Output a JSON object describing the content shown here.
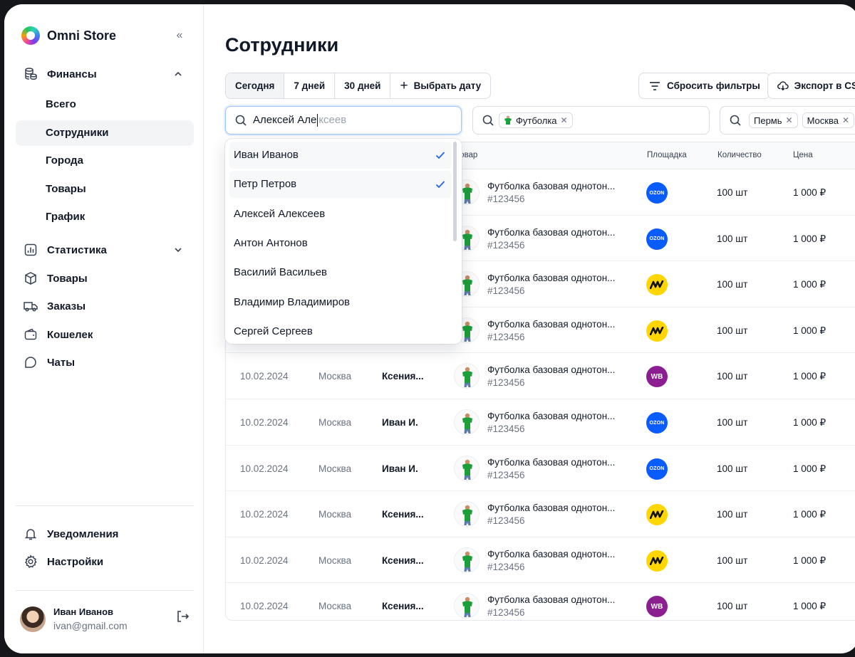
{
  "brand": {
    "name": "Omni Store"
  },
  "sidebar": {
    "finance": {
      "label": "Финансы",
      "icon": "coins-icon"
    },
    "finance_sub": [
      {
        "label": "Всего"
      },
      {
        "label": "Сотрудники"
      },
      {
        "label": "Города"
      },
      {
        "label": "Товары"
      },
      {
        "label": "График"
      }
    ],
    "items": [
      {
        "label": "Статистика",
        "icon": "chart-icon"
      },
      {
        "label": "Товары",
        "icon": "box-icon"
      },
      {
        "label": "Заказы",
        "icon": "truck-icon"
      },
      {
        "label": "Кошелек",
        "icon": "wallet-icon"
      },
      {
        "label": "Чаты",
        "icon": "chat-icon"
      }
    ],
    "bottom": [
      {
        "label": "Уведомления",
        "icon": "bell-icon"
      },
      {
        "label": "Настройки",
        "icon": "gear-icon"
      }
    ],
    "user": {
      "name": "Иван Иванов",
      "email": "ivan@gmail.com"
    }
  },
  "main": {
    "title": "Сотрудники",
    "periods": [
      "Сегодня",
      "7 дней",
      "30 дней",
      "Выбрать дату"
    ],
    "reset_label": "Сбросить фильтры",
    "export_label": "Экспорт в CSV",
    "employee_search": {
      "typed": "Алексей Але",
      "suggestion": "ксеев"
    },
    "product_filter": {
      "chip": "Футболка"
    },
    "city_filter": {
      "chips": [
        "Пермь",
        "Москва"
      ]
    },
    "columns": {
      "product": "Товар",
      "marketplace": "Площадка",
      "quantity": "Количество",
      "price": "Цена"
    },
    "rows": [
      {
        "date": "",
        "city": "",
        "employee": "",
        "product": "Футболка базовая однотон...",
        "sku": "#123456",
        "marketplace": "ozon",
        "qty": "100 шт",
        "price": "1 000 ₽"
      },
      {
        "date": "",
        "city": "",
        "employee": "",
        "product": "Футболка базовая однотон...",
        "sku": "#123456",
        "marketplace": "ozon",
        "qty": "100 шт",
        "price": "1 000 ₽"
      },
      {
        "date": "",
        "city": "",
        "employee": "",
        "product": "Футболка базовая однотон...",
        "sku": "#123456",
        "marketplace": "yandex-market",
        "qty": "100 шт",
        "price": "1 000 ₽"
      },
      {
        "date": "",
        "city": "",
        "employee": "",
        "product": "Футболка базовая однотон...",
        "sku": "#123456",
        "marketplace": "yandex-market",
        "qty": "100 шт",
        "price": "1 000 ₽"
      },
      {
        "date": "10.02.2024",
        "city": "Москва",
        "employee": "Ксения...",
        "product": "Футболка базовая однотон...",
        "sku": "#123456",
        "marketplace": "wildberries",
        "qty": "100 шт",
        "price": "1 000 ₽"
      },
      {
        "date": "10.02.2024",
        "city": "Москва",
        "employee": "Иван И.",
        "product": "Футболка базовая однотон...",
        "sku": "#123456",
        "marketplace": "ozon",
        "qty": "100 шт",
        "price": "1 000 ₽"
      },
      {
        "date": "10.02.2024",
        "city": "Москва",
        "employee": "Иван И.",
        "product": "Футболка базовая однотон...",
        "sku": "#123456",
        "marketplace": "ozon",
        "qty": "100 шт",
        "price": "1 000 ₽"
      },
      {
        "date": "10.02.2024",
        "city": "Москва",
        "employee": "Ксения...",
        "product": "Футболка базовая однотон...",
        "sku": "#123456",
        "marketplace": "yandex-market",
        "qty": "100 шт",
        "price": "1 000 ₽"
      },
      {
        "date": "10.02.2024",
        "city": "Москва",
        "employee": "Ксения...",
        "product": "Футболка базовая однотон...",
        "sku": "#123456",
        "marketplace": "yandex-market",
        "qty": "100 шт",
        "price": "1 000 ₽"
      },
      {
        "date": "10.02.2024",
        "city": "Москва",
        "employee": "Ксения...",
        "product": "Футболка базовая однотон...",
        "sku": "#123456",
        "marketplace": "wildberries",
        "qty": "100 шт",
        "price": "1 000 ₽"
      }
    ],
    "dropdown": [
      {
        "name": "Иван Иванов",
        "checked": true
      },
      {
        "name": "Петр Петров",
        "checked": true
      },
      {
        "name": "Алексей Алексеев",
        "checked": false
      },
      {
        "name": "Антон Антонов",
        "checked": false
      },
      {
        "name": "Василий Васильев",
        "checked": false
      },
      {
        "name": "Владимир Владимиров",
        "checked": false
      },
      {
        "name": "Сергей Сергеев",
        "checked": false
      }
    ]
  },
  "marketplace_labels": {
    "ozon": "OZON",
    "wildberries": "WB"
  },
  "colors": {
    "ozon": "#0b5cff",
    "yandex_market": "#ffd600",
    "wildberries": "#8b1f91",
    "accent": "#2563eb"
  }
}
